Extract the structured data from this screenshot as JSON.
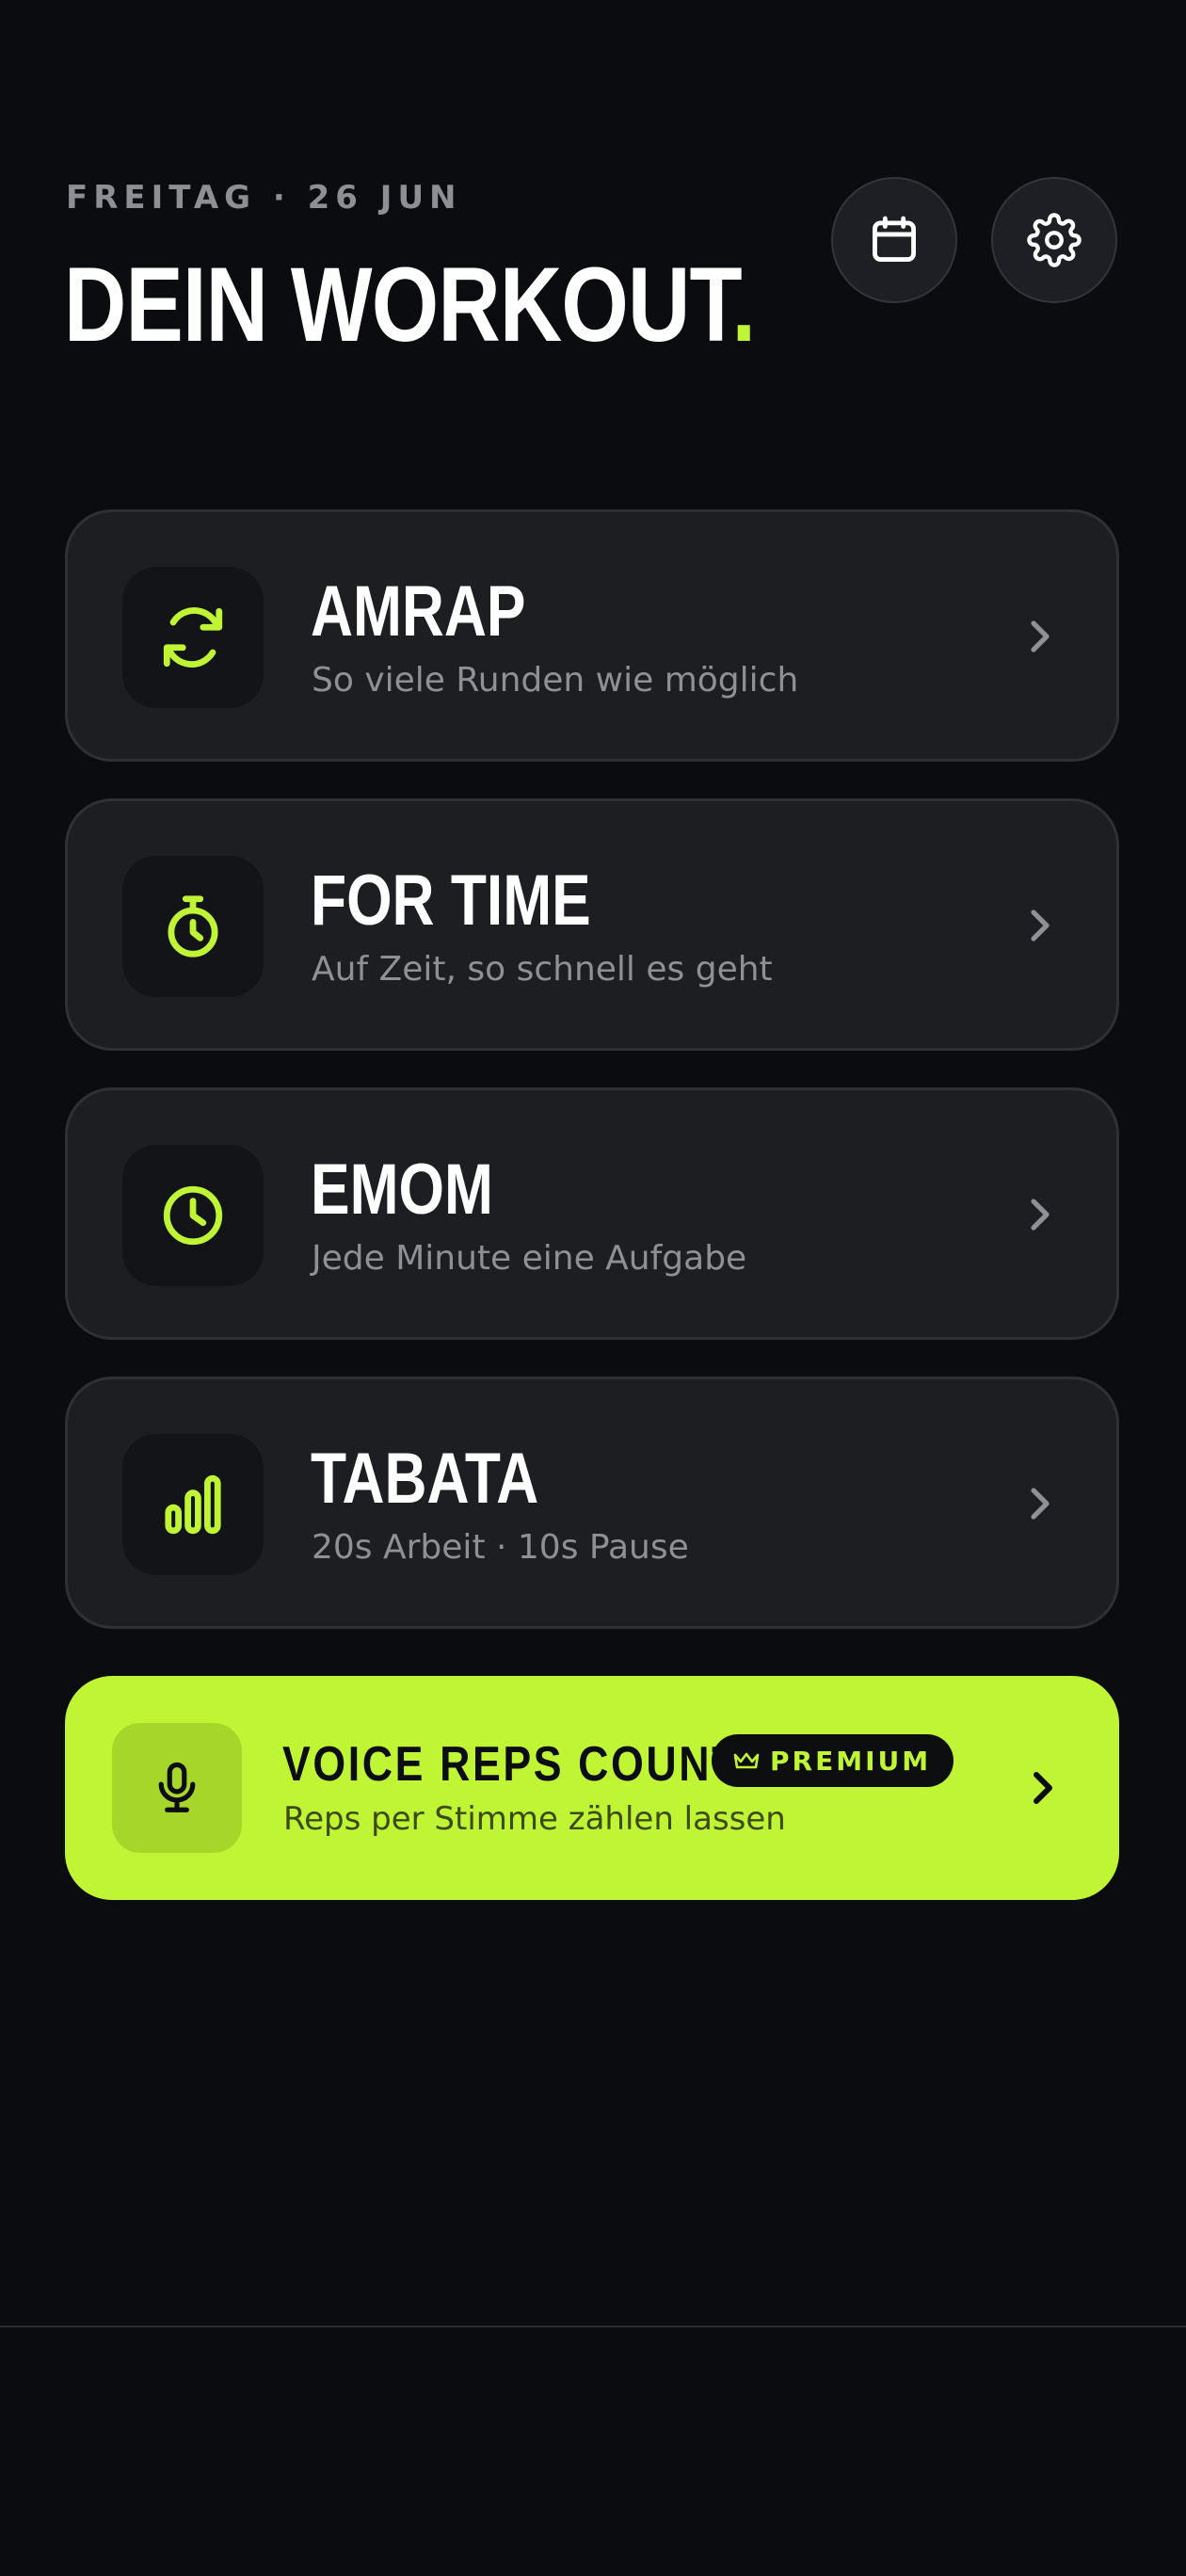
{
  "header": {
    "date": "FREITAG · 26 JUN",
    "title": "DEIN WORKOUT",
    "title_dot": "."
  },
  "actions": {
    "calendar_icon": "calendar-icon",
    "settings_icon": "gear-icon"
  },
  "workouts": [
    {
      "title": "AMRAP",
      "subtitle": "So viele Runden wie möglich",
      "icon": "refresh-icon"
    },
    {
      "title": "FOR TIME",
      "subtitle": "Auf Zeit, so schnell es geht",
      "icon": "stopwatch-icon"
    },
    {
      "title": "EMOM",
      "subtitle": "Jede Minute eine Aufgabe",
      "icon": "clock-icon"
    },
    {
      "title": "TABATA",
      "subtitle": "20s Arbeit · 10s Pause",
      "icon": "bars-icon"
    }
  ],
  "premium": {
    "title": "VOICE REPS COUNTER",
    "badge": "PREMIUM",
    "subtitle": "Reps per Stimme zählen lassen",
    "icon": "microphone-icon"
  },
  "colors": {
    "background": "#0b0c0f",
    "accent": "#c0f535",
    "card": "#1d1e22",
    "muted_text": "#8e9096"
  }
}
